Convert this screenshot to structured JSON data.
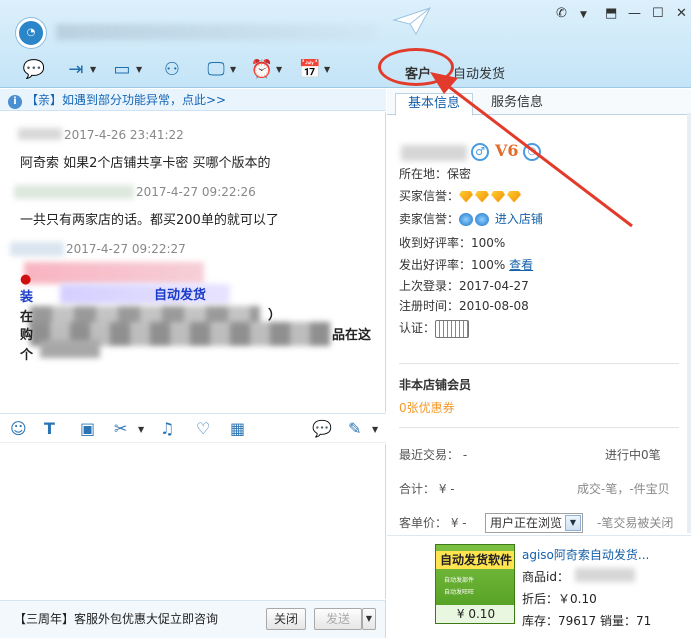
{
  "toolbar": {
    "customer_tab": "客户",
    "auto_ship_tab": "自动发货"
  },
  "notice": {
    "text": "【亲】如遇到部分功能异常，点此>>"
  },
  "chat": {
    "messages": [
      {
        "time": "2017-4-26 23:41:22",
        "text": "阿奇索  如果2个店铺共享卡密 买哪个版本的"
      },
      {
        "time": "2017-4-27 09:22:26",
        "text": "一共只有两家店的话。都买200单的就可以了"
      },
      {
        "time": "2017-4-27 09:22:27",
        "line1": "装",
        "line1_end": "自动发货",
        "line2": "在",
        "line2_end": "）",
        "line3": "购",
        "line3_end": "品在这",
        "line4": "个"
      }
    ]
  },
  "bottom": {
    "promo": "【三周年】客服外包优惠大促立即咨询",
    "close_btn": "关闭",
    "send_btn": "发送"
  },
  "right": {
    "tabs": [
      "基本信息",
      "服务信息"
    ],
    "level_badge": "V6",
    "location_label": "所在地：保密",
    "buyer_credit_label": "买家信誉：",
    "seller_credit_label": "卖家信誉：",
    "enter_shop": "进入店铺",
    "received_rate": "收到好评率：100%",
    "sent_rate_label": "发出好评率：100%",
    "view_link": "查看",
    "last_login": "上次登录：2017-04-27",
    "register_time": "注册时间：2010-08-08",
    "auth_label": "认证：",
    "member_status": "非本店铺会员",
    "coupon": "0张优惠券",
    "recent_trade_label": "最近交易：  -",
    "in_progress": "进行中0笔",
    "total_label": "合计：  ¥ -",
    "deal_info": "成交-笔，-件宝贝",
    "unit_price_label": "客单价：  ¥ -",
    "browsing": "用户正在浏览",
    "closed_deals": "-笔交易被关闭"
  },
  "product": {
    "image_title": "自动发货软件",
    "image_sub1": "自动发部件",
    "image_sub2": "自动发旺旺",
    "image_price": "¥ 0.10",
    "title": "agiso阿奇索自动发货...",
    "id_label": "商品id：",
    "discount": "折后：￥0.10",
    "stock_sales": "库存：79617 销量：71"
  },
  "colors": {
    "accent": "#1560a8",
    "annotation_red": "#e23b2b",
    "coupon_orange": "#f39a2b"
  }
}
